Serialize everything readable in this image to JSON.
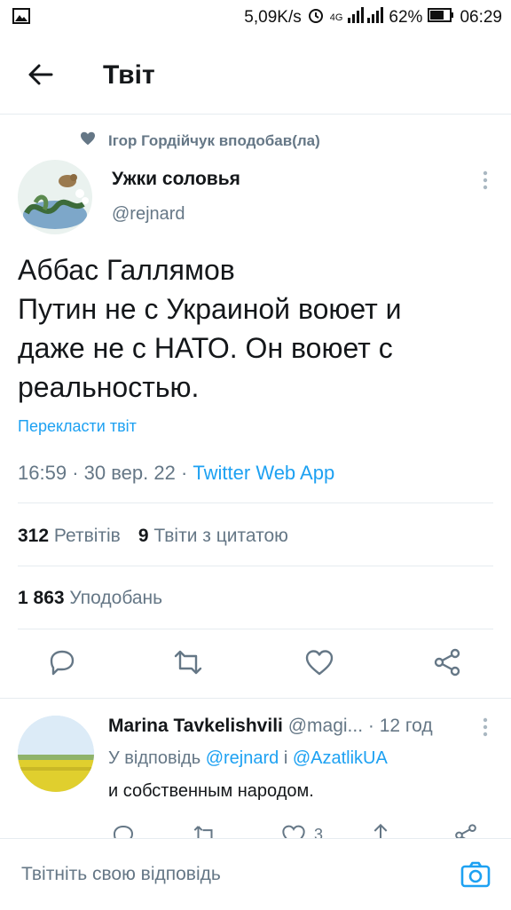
{
  "status_bar": {
    "speed": "5,09K/s",
    "network": "4G",
    "battery": "62%",
    "time": "06:29"
  },
  "header": {
    "title": "Твіт"
  },
  "social_context": {
    "text": "Ігор Гордійчук вподобав(ла)"
  },
  "tweet": {
    "author_name": "Ужки соловья",
    "author_handle": "@rejnard",
    "text_lines": [
      "Аббас Галлямов",
      "Путин не с Украиной воюет и",
      "даже не с НАТО. Он воюет с",
      "реальностью."
    ],
    "translate_label": "Перекласти твіт",
    "time": "16:59",
    "date": "30 вер. 22",
    "app": "Twitter Web App",
    "retweets_count": "312",
    "retweets_label": "Ретвітів",
    "quotes_count": "9",
    "quotes_label": "Твіти з цитатою",
    "likes_count": "1 863",
    "likes_label": "Уподобань"
  },
  "reply": {
    "author_name": "Marina Tavkelishvili",
    "author_handle": "@magi...",
    "time": "12 год",
    "reply_to_prefix": "У відповідь",
    "mention_1": "@rejnard",
    "conjunction": "і",
    "mention_2": "@AzatlikUA",
    "text": "и собственным народом.",
    "like_count": "3"
  },
  "composer": {
    "placeholder": "Твітніть свою відповідь"
  },
  "colors": {
    "accent": "#1da1f2",
    "secondary_text": "#657786",
    "primary_text": "#14171a"
  }
}
